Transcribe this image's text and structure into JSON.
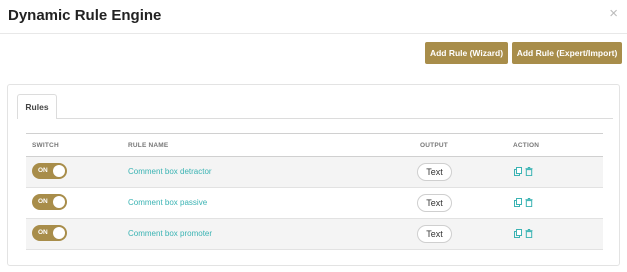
{
  "header": {
    "title": "Dynamic Rule Engine",
    "close_glyph": "×"
  },
  "toolbar": {
    "add_wizard_label": "Add Rule (Wizard)",
    "add_expert_label": "Add Rule (Expert/Import)"
  },
  "tabs": [
    {
      "label": "Rules",
      "active": true
    }
  ],
  "table": {
    "columns": [
      "SWITCH",
      "RULE NAME",
      "OUTPUT",
      "ACTION"
    ],
    "rows": [
      {
        "switch": "ON",
        "name": "Comment box detractor",
        "output": "Text",
        "actions": [
          "copy-icon",
          "trash-icon"
        ]
      },
      {
        "switch": "ON",
        "name": "Comment box passive",
        "output": "Text",
        "actions": [
          "copy-icon",
          "trash-icon"
        ]
      },
      {
        "switch": "ON",
        "name": "Comment box promoter",
        "output": "Text",
        "actions": [
          "copy-icon",
          "trash-icon"
        ]
      }
    ]
  },
  "colors": {
    "accent": "#a88d4a",
    "link": "#3ab3b3",
    "row_alt": "#f4f4f4"
  }
}
